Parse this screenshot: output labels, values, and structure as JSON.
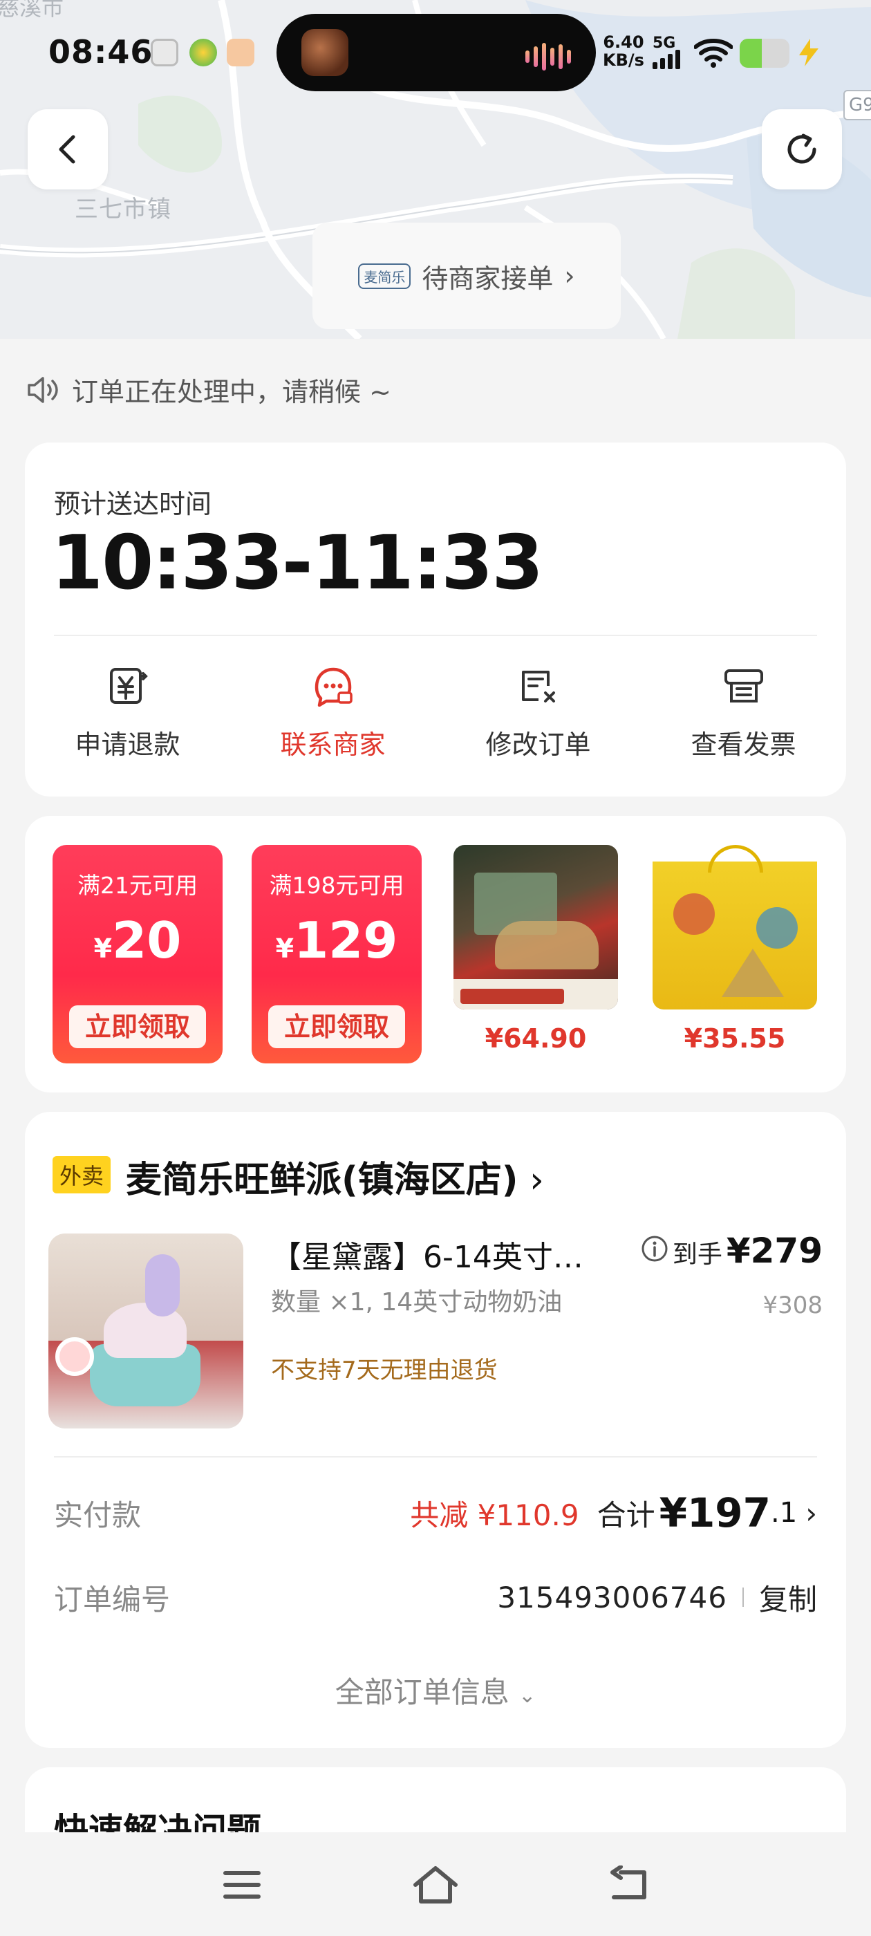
{
  "status_bar": {
    "time": "08:46",
    "net_speed_value": "6.40",
    "net_speed_unit": "KB/s",
    "network": "5G",
    "battery_level": 0.45
  },
  "map": {
    "town_label": "三七市镇",
    "road_badge": "G9",
    "status_logo": "麦简乐",
    "status_text": "待商家接单"
  },
  "notice": {
    "text": "订单正在处理中，请稍候 ~",
    "icon": "speaker-icon"
  },
  "eta": {
    "label": "预计送达时间",
    "time": "10:33-11:33"
  },
  "actions": [
    {
      "label": "申请退款",
      "icon": "refund-icon"
    },
    {
      "label": "联系商家",
      "icon": "chat-merchant-icon"
    },
    {
      "label": "修改订单",
      "icon": "edit-order-icon"
    },
    {
      "label": "查看发票",
      "icon": "invoice-icon"
    }
  ],
  "promo": {
    "coupons": [
      {
        "condition": "满21元可用",
        "currency": "¥",
        "amount": "20",
        "claim": "立即领取"
      },
      {
        "condition": "满198元可用",
        "currency": "¥",
        "amount": "129",
        "claim": "立即领取"
      }
    ],
    "products": [
      {
        "price": "¥64.90"
      },
      {
        "price": "¥35.55"
      }
    ]
  },
  "order": {
    "tag": "外卖",
    "shop_name": "麦简乐旺鲜派(镇海区店)",
    "item": {
      "title": "【星黛露】6-14英寸…",
      "spec": "数量 ×1, 14英寸动物奶油",
      "policy": "不支持7天无理由退货",
      "price_label": "到手",
      "price": "¥279",
      "original_price": "¥308"
    },
    "payment": {
      "label": "实付款",
      "discount": "共减 ¥110.9",
      "total_label": "合计",
      "total_int": "¥197",
      "total_dec": ".1"
    },
    "order_number": {
      "label": "订单编号",
      "value": "315493006746",
      "copy": "复制"
    },
    "more": "全部订单信息"
  },
  "quick": {
    "title": "快速解决问题"
  },
  "colors": {
    "accent_red": "#e0372c",
    "coupon_red": "#ff2a4a",
    "tag_yellow": "#ffd21f",
    "policy_brown": "#a46a1c"
  }
}
